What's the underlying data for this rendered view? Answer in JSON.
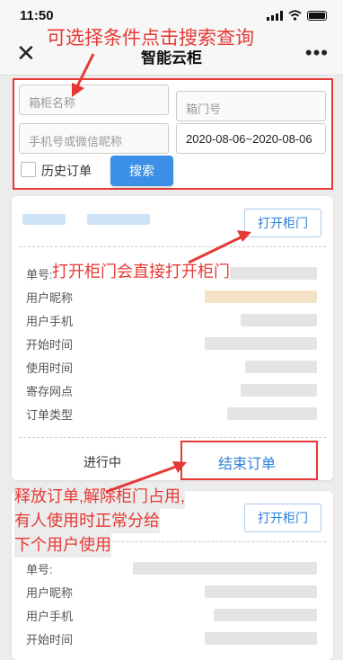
{
  "status_bar": {
    "time": "11:50"
  },
  "nav": {
    "close_icon": "close-icon",
    "title": "智能云柜",
    "more_icon": "more-icon"
  },
  "search": {
    "cabinet_name_placeholder": "箱柜名称",
    "door_no_placeholder": "箱门号",
    "phone_placeholder": "手机号或微信昵称",
    "date_range": "2020-08-06~2020-08-06",
    "history_label": "历史订单",
    "history_checked": false,
    "search_button": "搜索"
  },
  "order_cards": [
    {
      "open_button": "打开柜门",
      "fields": [
        "单号:",
        "用户昵称",
        "用户手机",
        "开始时间",
        "使用时间",
        "寄存网点",
        "订单类型"
      ],
      "status": "进行中",
      "end_button": "结束订单"
    },
    {
      "open_button": "打开柜门",
      "fields": [
        "单号:",
        "用户昵称",
        "用户手机",
        "开始时间"
      ]
    }
  ],
  "annotations": {
    "search_hint": "可选择条件点击搜索查询",
    "open_hint": "打开柜门会直接打开柜门",
    "end_hint_lines": [
      "释放订单,解除柜门占用,",
      "有人使用时正常分给",
      "下个用户使用"
    ]
  },
  "colors": {
    "annotation": "#e53935",
    "accent": "#2d7fd9",
    "search_button": "#3b8fe4"
  }
}
